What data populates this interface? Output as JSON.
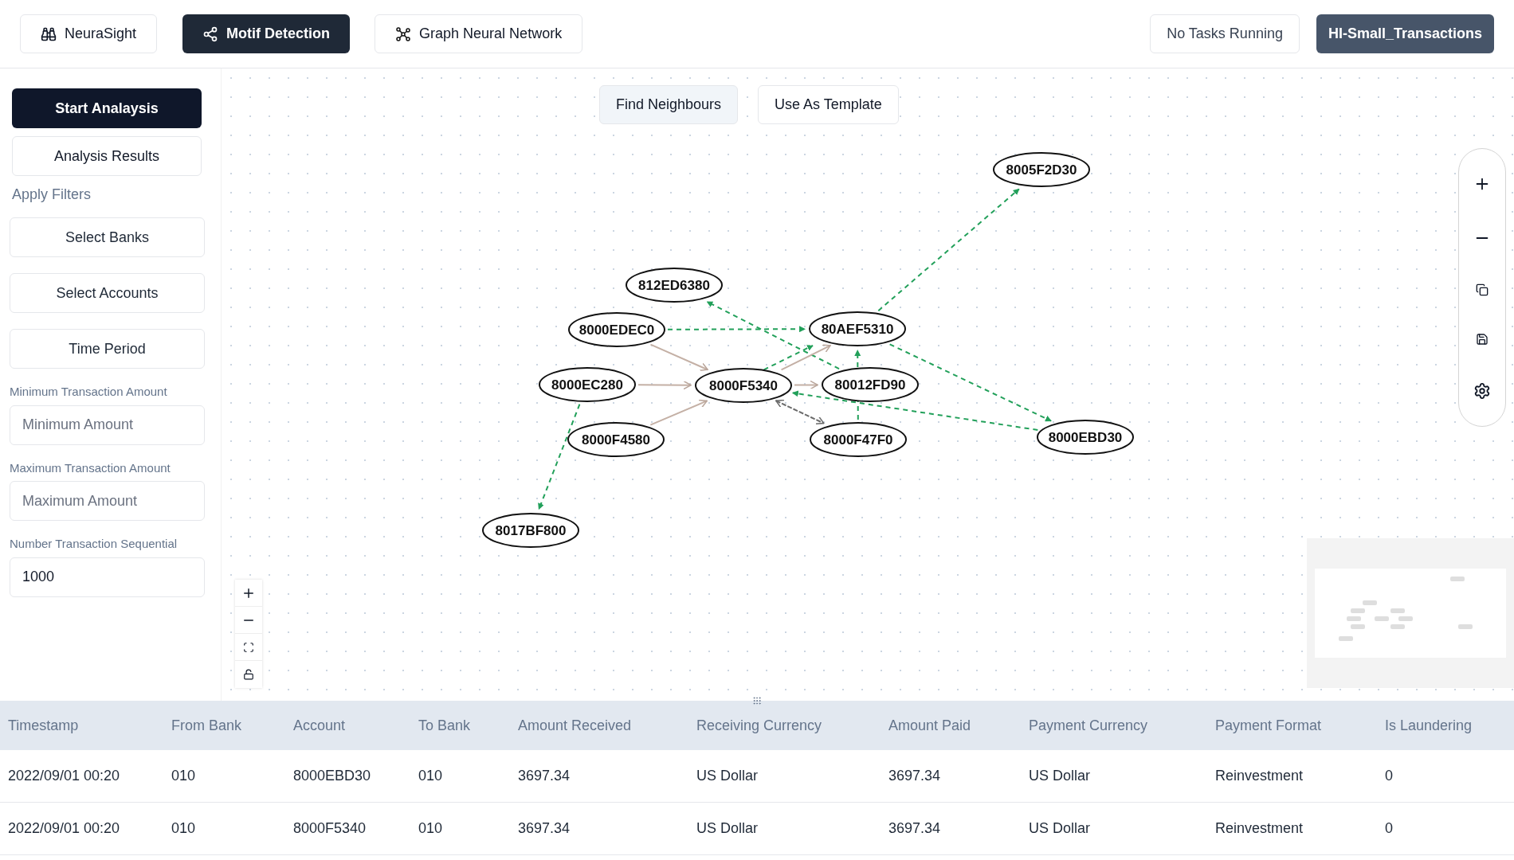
{
  "nav": {
    "brand": "NeuraSight",
    "tabs": [
      {
        "label": "Motif Detection",
        "selected": true
      },
      {
        "label": "Graph Neural Network",
        "selected": false
      }
    ],
    "status": "No Tasks Running",
    "dataset": "HI-Small_Transactions"
  },
  "sidebar": {
    "primary_button": "Start Analaysis",
    "results_button": "Analysis Results",
    "filters_heading": "Apply Filters",
    "filter_buttons": [
      "Select Banks",
      "Select Accounts",
      "Time Period"
    ],
    "fields": [
      {
        "label": "Minimum Transaction Amount",
        "placeholder": "Minimum Amount"
      },
      {
        "label": "Maximum Transaction Amount",
        "placeholder": "Maximum Amount"
      },
      {
        "label": "Number Transaction Sequential",
        "value": "1000"
      }
    ]
  },
  "canvas": {
    "actions": [
      {
        "label": "Find Neighbours",
        "selected": true
      },
      {
        "label": "Use As Template",
        "selected": false
      }
    ],
    "nodes": [
      "8005F2D30",
      "812ED6380",
      "8000EDEC0",
      "80AEF5310",
      "8000EC280",
      "8000F5340",
      "80012FD90",
      "8000F4580",
      "8000F47F0",
      "8000EBD30",
      "8017BF800"
    ],
    "edges": [
      {
        "kind": "suggested"
      },
      {
        "kind": "suggested"
      },
      {
        "kind": "suggested"
      },
      {
        "kind": "suggested"
      },
      {
        "kind": "suggested"
      },
      {
        "kind": "suggested"
      },
      {
        "kind": "suggested"
      },
      {
        "kind": "suggested"
      },
      {
        "kind": "transaction"
      },
      {
        "kind": "transaction"
      },
      {
        "kind": "transaction"
      },
      {
        "kind": "transaction"
      },
      {
        "kind": "transaction"
      },
      {
        "kind": "mutual"
      }
    ]
  },
  "table": {
    "columns": [
      "Timestamp",
      "From Bank",
      "Account",
      "To Bank",
      "Amount Received",
      "Receiving Currency",
      "Amount Paid",
      "Payment Currency",
      "Payment Format",
      "Is Laundering"
    ],
    "rows": [
      [
        "2022/09/01 00:20",
        "010",
        "8000EBD30",
        "010",
        "3697.34",
        "US Dollar",
        "3697.34",
        "US Dollar",
        "Reinvestment",
        "0"
      ],
      [
        "2022/09/01 00:20",
        "010",
        "8000F5340",
        "010",
        "3697.34",
        "US Dollar",
        "3697.34",
        "US Dollar",
        "Reinvestment",
        "0"
      ]
    ]
  }
}
